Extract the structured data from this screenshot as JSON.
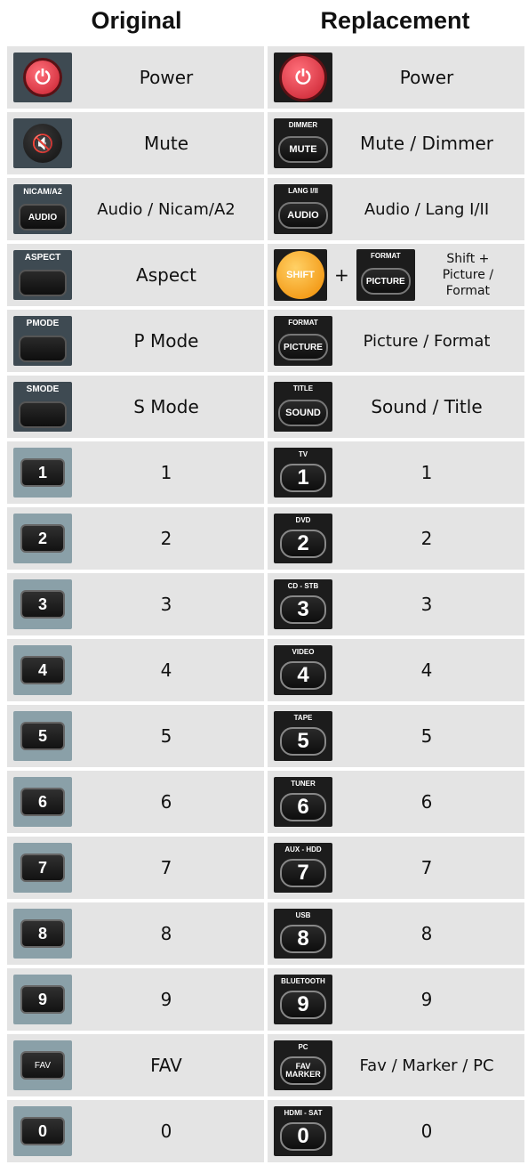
{
  "headers": {
    "original": "Original",
    "replacement": "Replacement"
  },
  "rows": [
    {
      "orig_icon": "power-icon",
      "orig_label": "Power",
      "rep_icon": "power-icon",
      "rep_label": "Power"
    },
    {
      "orig_icon": "mute-icon",
      "orig_label": "Mute",
      "rep_key_top": "DIMMER",
      "rep_key": "MUTE",
      "rep_label": "Mute / Dimmer"
    },
    {
      "orig_key_top": "NICAM/A2",
      "orig_key": "AUDIO",
      "orig_label": "Audio / Nicam/A2",
      "rep_key_top": "LANG I/II",
      "rep_key": "AUDIO",
      "rep_label": "Audio / Lang I/II"
    },
    {
      "orig_key_top": "ASPECT",
      "orig_label": "Aspect",
      "rep_shift": "SHIFT",
      "rep_plus": "+",
      "rep_key_top": "FORMAT",
      "rep_key": "PICTURE",
      "rep_label_lines": [
        "Shift +",
        "Picture /",
        "Format"
      ]
    },
    {
      "orig_key_top": "PMODE",
      "orig_label": "P Mode",
      "rep_key_top": "FORMAT",
      "rep_key": "PICTURE",
      "rep_label": "Picture / Format"
    },
    {
      "orig_key_top": "SMODE",
      "orig_label": "S Mode",
      "rep_key_top": "TITLE",
      "rep_key": "SOUND",
      "rep_label": "Sound / Title"
    },
    {
      "orig_key": "1",
      "orig_label": "1",
      "rep_key_top": "TV",
      "rep_key": "1",
      "rep_label": "1"
    },
    {
      "orig_key": "2",
      "orig_label": "2",
      "rep_key_top": "DVD",
      "rep_key": "2",
      "rep_label": "2"
    },
    {
      "orig_key": "3",
      "orig_label": "3",
      "rep_key_top": "CD - STB",
      "rep_key": "3",
      "rep_label": "3"
    },
    {
      "orig_key": "4",
      "orig_label": "4",
      "rep_key_top": "VIDEO",
      "rep_key": "4",
      "rep_label": "4"
    },
    {
      "orig_key": "5",
      "orig_label": "5",
      "rep_key_top": "TAPE",
      "rep_key": "5",
      "rep_label": "5"
    },
    {
      "orig_key": "6",
      "orig_label": "6",
      "rep_key_top": "TUNER",
      "rep_key": "6",
      "rep_label": "6"
    },
    {
      "orig_key": "7",
      "orig_label": "7",
      "rep_key_top": "AUX - HDD",
      "rep_key": "7",
      "rep_label": "7"
    },
    {
      "orig_key": "8",
      "orig_label": "8",
      "rep_key_top": "USB",
      "rep_key": "8",
      "rep_label": "8"
    },
    {
      "orig_key": "9",
      "orig_label": "9",
      "rep_key_top": "BLUETOOTH",
      "rep_key": "9",
      "rep_label": "9"
    },
    {
      "orig_key": "FAV",
      "orig_label": "FAV",
      "rep_key_top": "PC",
      "rep_key": "FAV MARKER",
      "rep_label": "Fav / Marker / PC"
    },
    {
      "orig_key": "0",
      "orig_label": "0",
      "rep_key_top": "HDMI - SAT",
      "rep_key": "0",
      "rep_label": "0"
    }
  ]
}
